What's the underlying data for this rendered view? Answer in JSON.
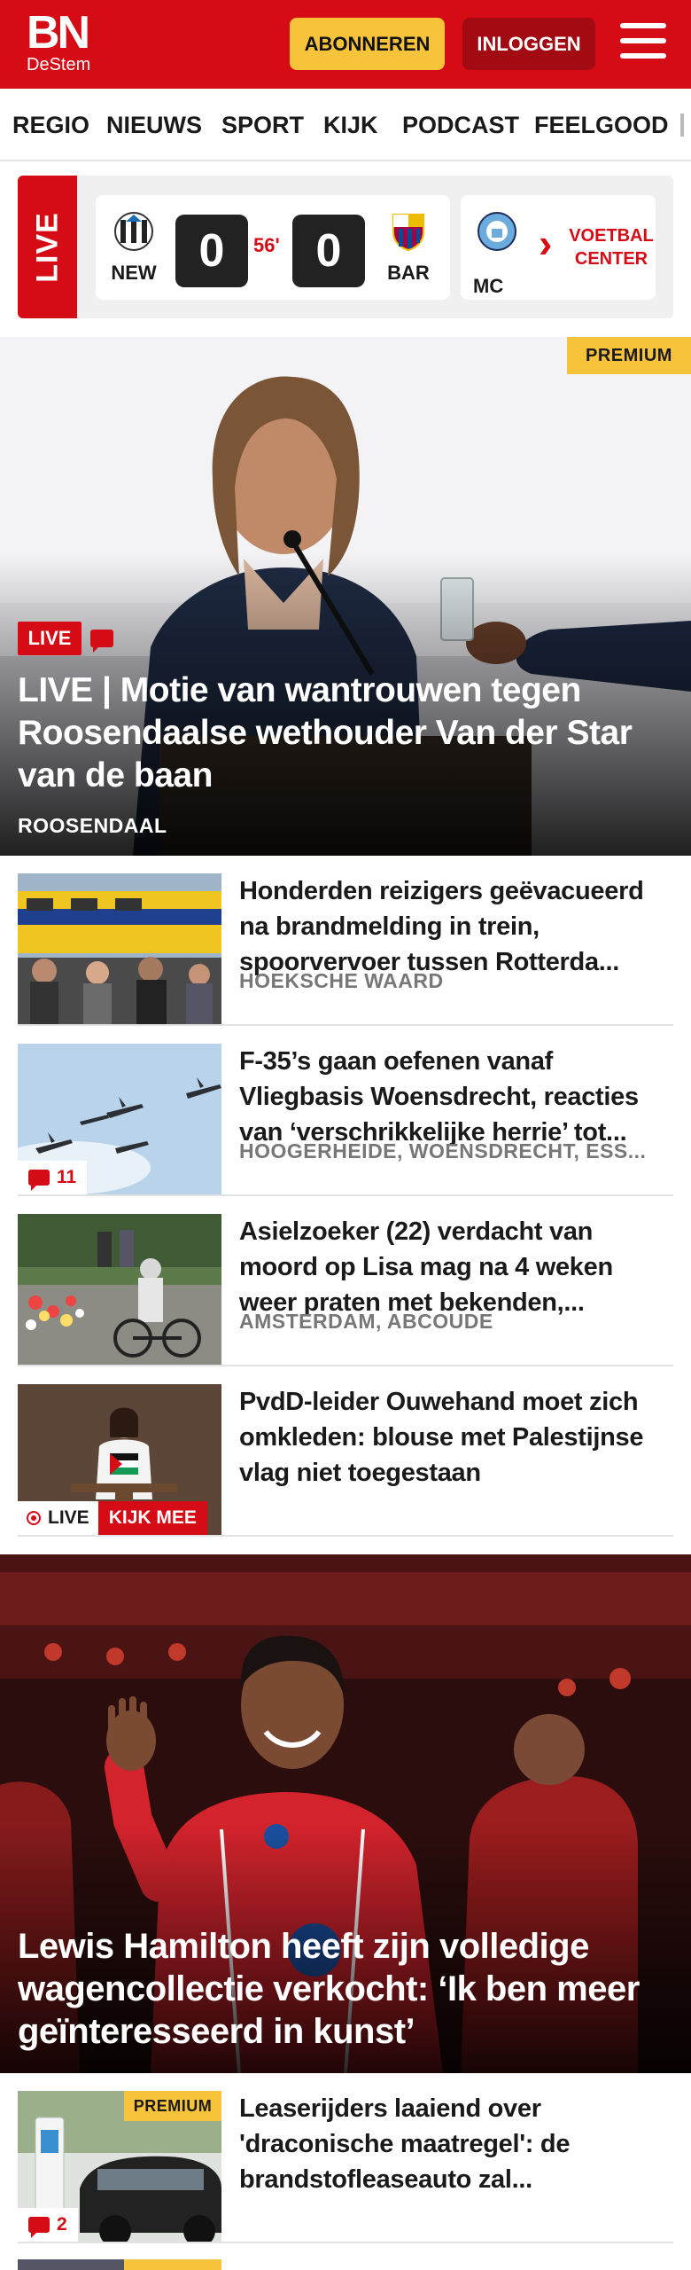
{
  "header": {
    "logo_main": "BN",
    "logo_sub": "DeStem",
    "subscribe_label": "ABONNEREN",
    "login_label": "INLOGGEN"
  },
  "nav": {
    "items": [
      {
        "label": "REGIO"
      },
      {
        "label": "NIEUWS"
      },
      {
        "label": "SPORT"
      },
      {
        "label": "KIJK"
      },
      {
        "label": "PODCAST"
      },
      {
        "label": "FEELGOOD"
      }
    ]
  },
  "live_scores": {
    "live_label": "LIVE",
    "match": {
      "home": "NEW",
      "away": "BAR",
      "home_score": "0",
      "away_score": "0",
      "minute": "56'"
    },
    "next_match_home": "MC",
    "voetbal_center_label": "VOETBAL CENTER"
  },
  "hero": {
    "premium_label": "PREMIUM",
    "live_label": "LIVE",
    "title": "LIVE | Motie van wantrouwen tegen Roosendaalse wethouder Van der Star van de baan",
    "location": "ROOSENDAAL"
  },
  "articles": [
    {
      "title": "Honderden reizigers geëvacu­eerd na brandmelding in trein, spoorvervoer tussen Rotterda...",
      "location": "HOEKSCHE WAARD"
    },
    {
      "title": "F-35’s gaan oefenen vanaf Vliegbasis Woensdrecht, reacties van ‘verschrikkelijke herrie’ tot...",
      "location": "HOOGERHEIDE, WOENSDRECHT, ESS...",
      "comments": "11"
    },
    {
      "title": "Asielzoeker (22) verdacht van moord op Lisa mag na 4 weken weer praten met bekenden,...",
      "location": "AMSTERDAM, ABCOUDE"
    },
    {
      "title": "PvdD-leider Ouwehand moet zich omkleden: blouse met Palestijn­se vlag niet toegestaan",
      "live_label": "LIVE",
      "watch_label": "KIJK MEE"
    }
  ],
  "feature": {
    "title": "Lewis Hamilton heeft zijn volledige wagencollectie verkocht: ‘Ik ben meer geïnteresseerd in kunst’"
  },
  "lease": {
    "premium_label": "PREMIUM",
    "title": "Leaserijders laaiend over 'draconische maatregel': de brandstofleaseauto zal...",
    "comments": "2"
  },
  "colors": {
    "brand_red": "#d50c16",
    "premium_yellow": "#f6c33a",
    "login_dark_red": "#a30b12"
  },
  "icons": [
    "menu-icon",
    "newcastle-crest-icon",
    "barcelona-crest-icon",
    "man-city-crest-icon",
    "chevron-right-icon",
    "comment-icon",
    "record-icon"
  ]
}
